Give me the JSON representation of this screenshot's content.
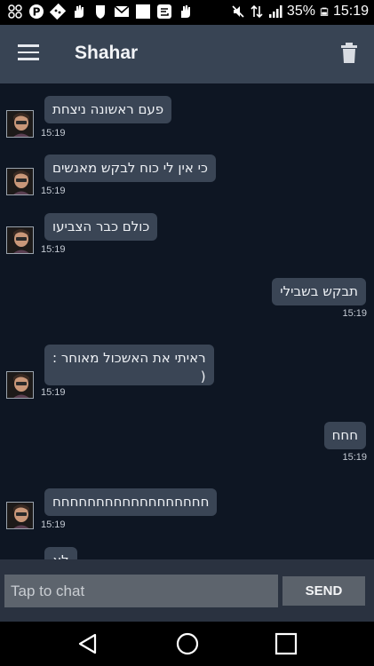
{
  "status_bar": {
    "battery_percent": "35%",
    "time": "15:19",
    "left_icons": [
      "pinwheel-app-icon",
      "pinterest-icon",
      "dominos-icon",
      "hand-app-icon",
      "shield-app-icon",
      "gmail-icon",
      "blank-square-icon",
      "chat-app-icon",
      "hand-app-icon"
    ],
    "right_icons": [
      "mute-icon",
      "data-transfer-icon",
      "signal-icon",
      "battery-icon"
    ]
  },
  "app_bar": {
    "title": "Shahar",
    "color": "#384454"
  },
  "messages": [
    {
      "side": "left",
      "text": "פעם ראשונה ניצחת",
      "time": "15:19"
    },
    {
      "side": "left",
      "text": "כי אין לי כוח לבקש מאנשים",
      "time": "15:19"
    },
    {
      "side": "left",
      "text": "כולם כבר הצביעו",
      "time": "15:19"
    },
    {
      "side": "right",
      "text": "תבקש בשבילי",
      "time": "15:19"
    },
    {
      "side": "left",
      "text": "ראיתי את האשכול מאוחר :",
      "text2": "(",
      "time": "15:19"
    },
    {
      "side": "right",
      "text": "חחח",
      "time": "15:19"
    },
    {
      "side": "left",
      "text": "חחחחחחחחחחחחחחחחחח",
      "time": "15:19"
    },
    {
      "side": "left",
      "text": "לא",
      "time": ""
    }
  ],
  "input": {
    "placeholder": "Tap to chat",
    "send_label": "SEND"
  },
  "colors": {
    "background": "#0e1623",
    "bubble": "#3a4555",
    "input_bar": "#2a3240"
  }
}
